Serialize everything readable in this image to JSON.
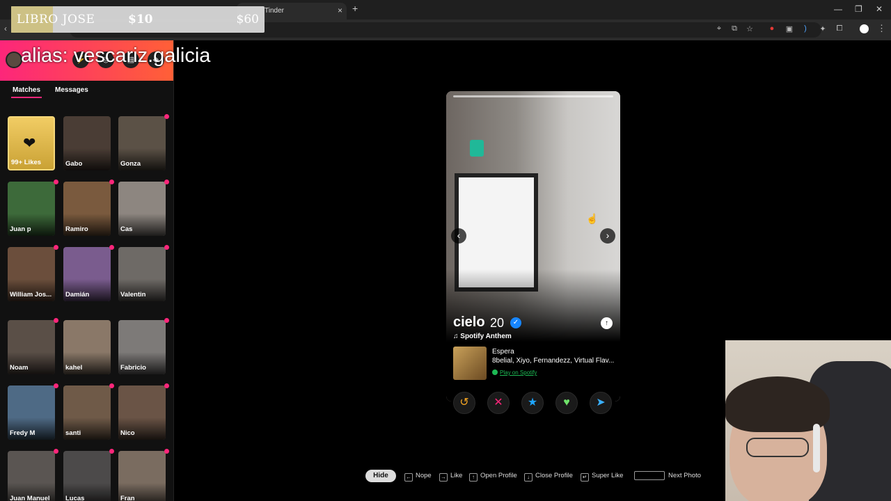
{
  "browser": {
    "tab_title": "Tinder",
    "tab_close": "×",
    "new_tab": "+",
    "window_controls": [
      "—",
      "❐",
      "✕"
    ],
    "back": "‹",
    "menu": "⋮"
  },
  "overlay": {
    "name": "LIBRO JOSE",
    "price_a": "$10",
    "price_b": "$60"
  },
  "alias": "alias: vescariz.galicia",
  "sidebar": {
    "tabs": [
      "Matches",
      "Messages"
    ],
    "likes_label": "99+ Likes",
    "matches": [
      "Gabo",
      "Gonza",
      "Juan p",
      "Ramiro",
      "Cas",
      "William Jos...",
      "Damián",
      "Valentin",
      "Noam",
      "kahel",
      "Fabricio",
      "Fredy M",
      "santi",
      "Nico",
      "Juan Manuel",
      "Lucas",
      "Fran"
    ]
  },
  "profile": {
    "name": "cielo",
    "age": "20",
    "anthem_label": "Spotify Anthem",
    "song_title": "Espera",
    "song_artists": "8belial, Xiyo, Fernandezz, Virtual Flav...",
    "spotify_link": "Play on Spotify"
  },
  "actions": [
    {
      "name": "rewind-button",
      "glyph": "↺",
      "color": "#f5a623"
    },
    {
      "name": "nope-button",
      "glyph": "✕",
      "color": "#fd267a"
    },
    {
      "name": "super-like-button",
      "glyph": "★",
      "color": "#1ea5ff"
    },
    {
      "name": "like-button",
      "glyph": "♥",
      "color": "#6fe36a"
    },
    {
      "name": "boost-button",
      "glyph": "➤",
      "color": "#3ab0ff"
    }
  ],
  "hints": {
    "hide": "Hide",
    "nope": "Nope",
    "like": "Like",
    "open_profile": "Open Profile",
    "close_profile": "Close Profile",
    "super_like": "Super Like",
    "next_photo": "Next Photo"
  }
}
